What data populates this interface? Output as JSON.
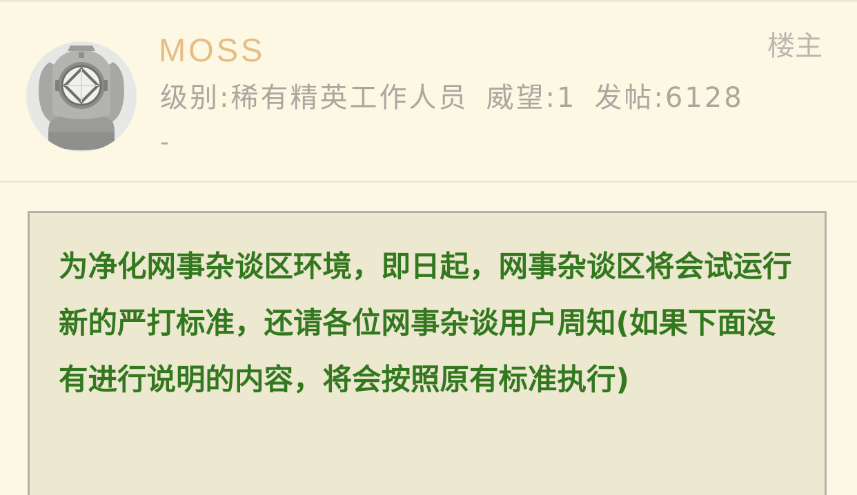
{
  "post": {
    "author": {
      "username": "MOSS",
      "level_label": "级别:稀有精英工作人员",
      "prestige_label": "威望:1",
      "posts_label": "发帖:6128",
      "signature": "-",
      "avatar_icon": "diving-helmet-icon"
    },
    "floor_tag": "楼主",
    "notice": {
      "text": "为净化网事杂谈区环境，即日起，网事杂谈区将会试运行新的严打标准，还请各位网事杂谈用户周知(如果下面没有进行说明的内容，将会按照原有标准执行)"
    }
  },
  "colors": {
    "background": "#fdf8e4",
    "username": "#e6bd85",
    "meta_text": "#a9a89f",
    "notice_bg": "#ede8d0",
    "notice_border": "#b2b2ac",
    "notice_text": "#33781f"
  }
}
